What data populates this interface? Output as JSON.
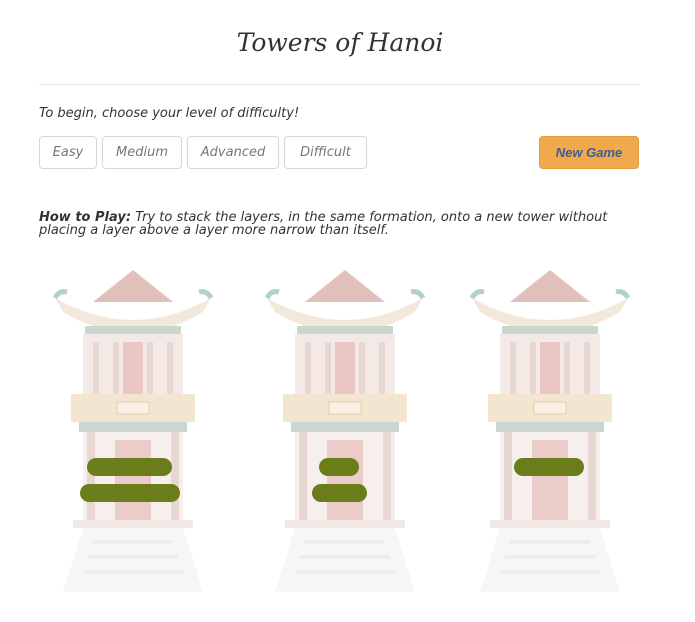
{
  "title": "Towers of Hanoi",
  "instructions": "To begin, choose your level of difficulty!",
  "difficulty": [
    {
      "label": "Easy"
    },
    {
      "label": "Medium"
    },
    {
      "label": "Advanced"
    },
    {
      "label": "Difficult"
    }
  ],
  "new_game_label": "New Game",
  "how_to": {
    "heading": "How to Play:",
    "text": " Try to stack the layers, in the same formation, onto a new tower without placing a layer above a layer more narrow than itself."
  },
  "colors": {
    "accent": "#f1a94e",
    "disk": "#6b7d1b"
  },
  "towers": [
    {
      "disks": [
        {
          "size": "medium"
        },
        {
          "size": "large"
        }
      ]
    },
    {
      "disks": [
        {
          "size": "small"
        },
        {
          "size": "medium-small"
        }
      ]
    },
    {
      "disks": [
        {
          "size": "medium"
        }
      ]
    }
  ]
}
